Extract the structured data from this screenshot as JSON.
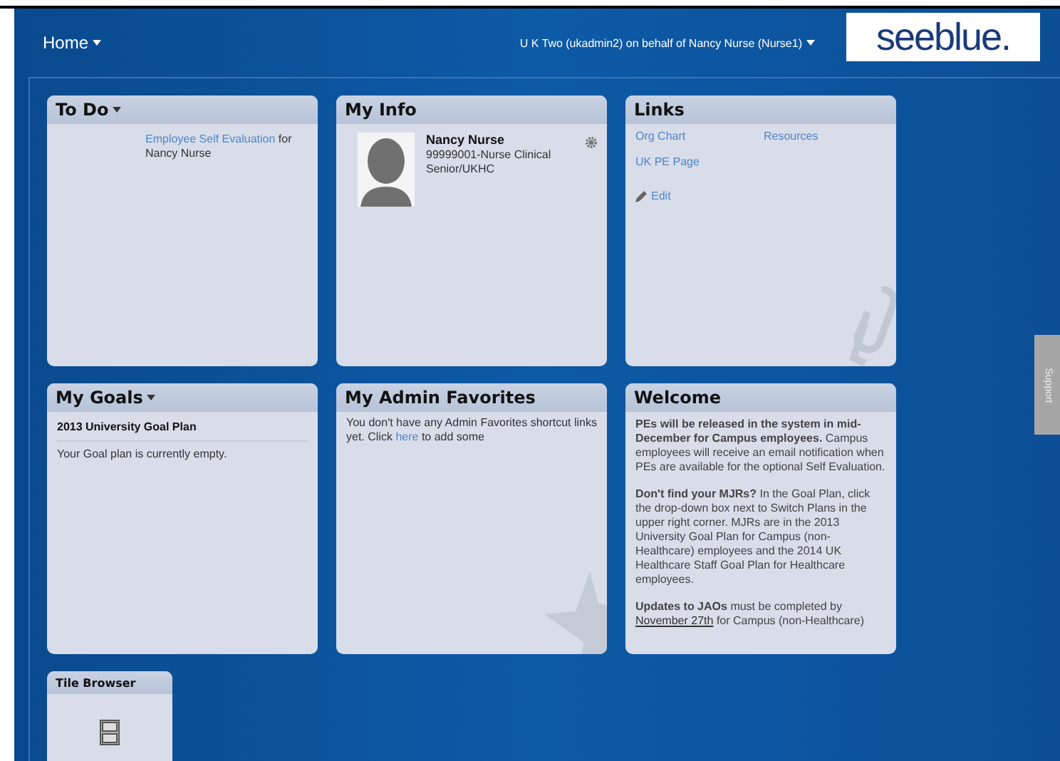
{
  "header": {
    "home": "Home",
    "user": "U K Two (ukadmin2) on behalf of Nancy Nurse (Nurse1)",
    "logo": "seeblue."
  },
  "tiles": [
    {
      "kind": "todo",
      "title": "To Do",
      "has_menu": true,
      "link": "Employee Self Evaluation",
      "text": "for",
      "line2": "Nancy Nurse"
    },
    {
      "kind": "myinfo",
      "title": "My Info",
      "has_menu": false,
      "name": "Nancy Nurse",
      "lines": [
        "99999001-Nurse Clinical",
        "Senior/UKHC"
      ]
    },
    {
      "kind": "links",
      "title": "Links",
      "has_menu": false,
      "links": [
        "Org Chart",
        "Resources",
        "UK PE Page"
      ],
      "edit": "Edit"
    },
    {
      "kind": "goals",
      "title": "My Goals",
      "has_menu": true,
      "plan": "2013 University Goal Plan",
      "empty": "Your Goal plan is currently empty."
    },
    {
      "kind": "favorites",
      "title": "My Admin Favorites",
      "has_menu": false,
      "before": "You don't have any Admin Favorites shortcut links yet. Click",
      "link": "here",
      "after": "to add some"
    },
    {
      "kind": "welcome",
      "title": "Welcome",
      "has_menu": false,
      "paragraphs": [
        {
          "text": "**PEs will be released in the system in mid-December for Campus employees.** Campus employees will receive an email notification when PEs are available for the optional Self Evaluation."
        },
        {
          "text": "**Don't find your MJRs?** In the Goal Plan, click the drop-down box next to Switch Plans in the upper right corner. MJRs are in the 2013 University Goal Plan for Campus (non-Healthcare) employees and the 2014 UK Healthcare Staff Goal Plan for Healthcare employees."
        },
        {
          "text": "**Updates to JAOs** must be completed by",
          "link": "November 27th",
          "after": "for Campus (non-Healthcare)"
        }
      ]
    }
  ],
  "tile_browser": {
    "title": "Tile Browser"
  },
  "support_tab": "Support"
}
